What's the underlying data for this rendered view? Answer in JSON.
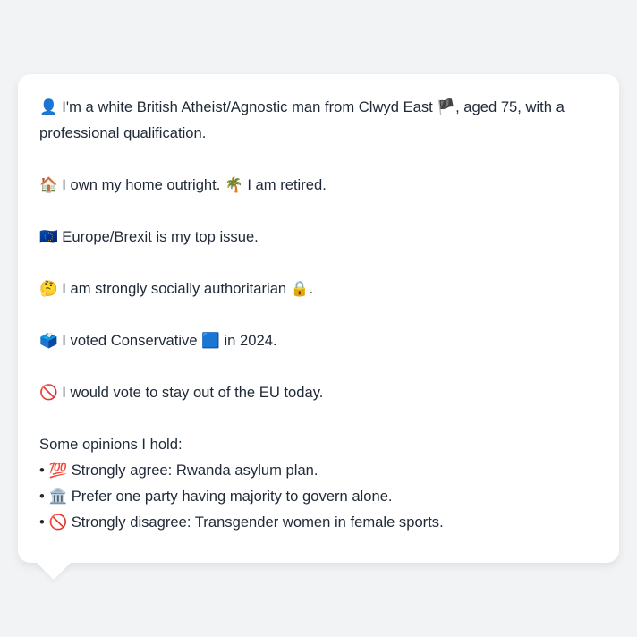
{
  "profile": {
    "paragraphs": [
      {
        "icon": "👤",
        "icon_name": "person-silhouette-icon",
        "text": "I'm a white British Atheist/Agnostic man from Clwyd East",
        "icon2": "🏴",
        "icon2_name": "wales-flag-icon",
        "text2": ", aged 75, with a professional qualification."
      },
      {
        "icon": "🏠",
        "icon_name": "house-icon",
        "text": "I own my home outright.",
        "icon2": "🌴",
        "icon2_name": "palm-tree-icon",
        "text2": "I am retired."
      },
      {
        "icon": "🇪🇺",
        "icon_name": "eu-flag-icon",
        "text": "Europe/Brexit is my top issue."
      },
      {
        "icon": "🤔",
        "icon_name": "thinking-face-icon",
        "text": "I am strongly socially authoritarian",
        "icon2": "🔒",
        "icon2_name": "lock-icon",
        "text2": "."
      },
      {
        "icon": "🗳️",
        "icon_name": "ballot-box-icon",
        "text": "I voted Conservative",
        "icon2": "🟦",
        "icon2_name": "blue-square-icon",
        "text2": "in 2024."
      },
      {
        "icon": "🚫",
        "icon_name": "prohibited-icon",
        "text": "I would vote to stay out of the EU today."
      }
    ],
    "opinions_heading": "Some opinions I hold:",
    "bullet": "•",
    "opinions": [
      {
        "icon": "💯",
        "icon_name": "hundred-points-icon",
        "text": "Strongly agree: Rwanda asylum plan."
      },
      {
        "icon": "🏛️",
        "icon_name": "classical-building-icon",
        "text": "Prefer one party having majority to govern alone."
      },
      {
        "icon": "🚫",
        "icon_name": "prohibited-icon",
        "text": "Strongly disagree: Transgender women in female sports."
      }
    ]
  }
}
